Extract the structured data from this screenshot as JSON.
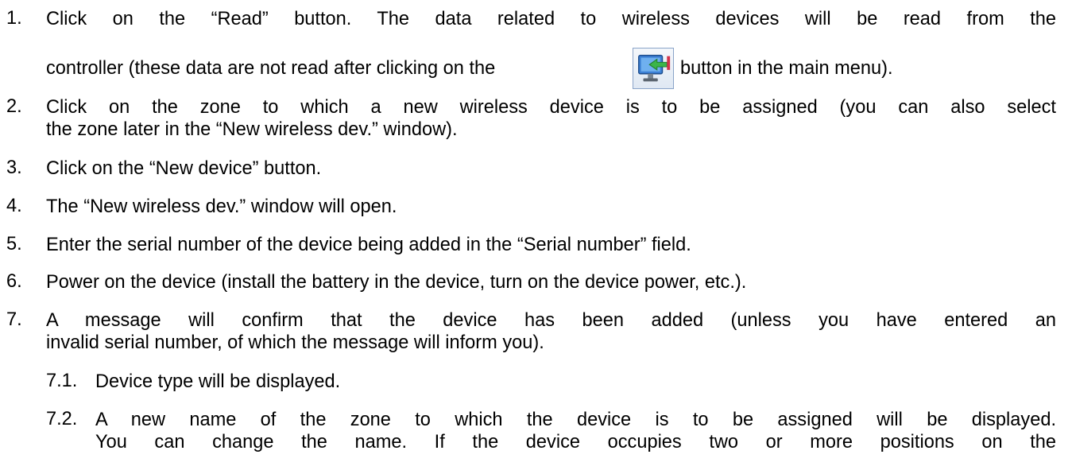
{
  "colors": {
    "text": "#000000",
    "background": "#ffffff",
    "icon_border": "#8aa4c8",
    "icon_monitor": "#3b7fd4",
    "icon_arrow": "#3bb54a",
    "icon_accent": "#d2334b"
  },
  "icons": {
    "read_data_button": "monitor-read-arrow-icon"
  },
  "steps": [
    {
      "number": "1.",
      "line1": "Click on the “Read” button. The data related to wireless devices will be read from the",
      "line2_before": "controller (these data are not read after clicking on the",
      "line2_after": "button in the main menu)."
    },
    {
      "number": "2.",
      "line1": "Click on the zone to which a new wireless device is to be assigned (you can also select",
      "line2": "the zone later in the “New wireless dev.” window)."
    },
    {
      "number": "3.",
      "line1": "Click on the “New device” button."
    },
    {
      "number": "4.",
      "line1": "The “New wireless dev.” window will open."
    },
    {
      "number": "5.",
      "line1": "Enter the serial number of the device being added in the “Serial number” field."
    },
    {
      "number": "6.",
      "line1": "Power on the device (install the battery in the device, turn on the device power, etc.)."
    },
    {
      "number": "7.",
      "line1": "A message will confirm that the device has been added (unless you have entered an",
      "line2": "invalid serial number, of which the message will inform you).",
      "substeps": [
        {
          "number": "7.1.",
          "line1": "Device type will be displayed."
        },
        {
          "number": "7.2.",
          "line1": "A new name of the zone to which the device is to be assigned will be displayed.",
          "line2": "You can change the name. If the device occupies two or more positions on the"
        }
      ]
    }
  ]
}
